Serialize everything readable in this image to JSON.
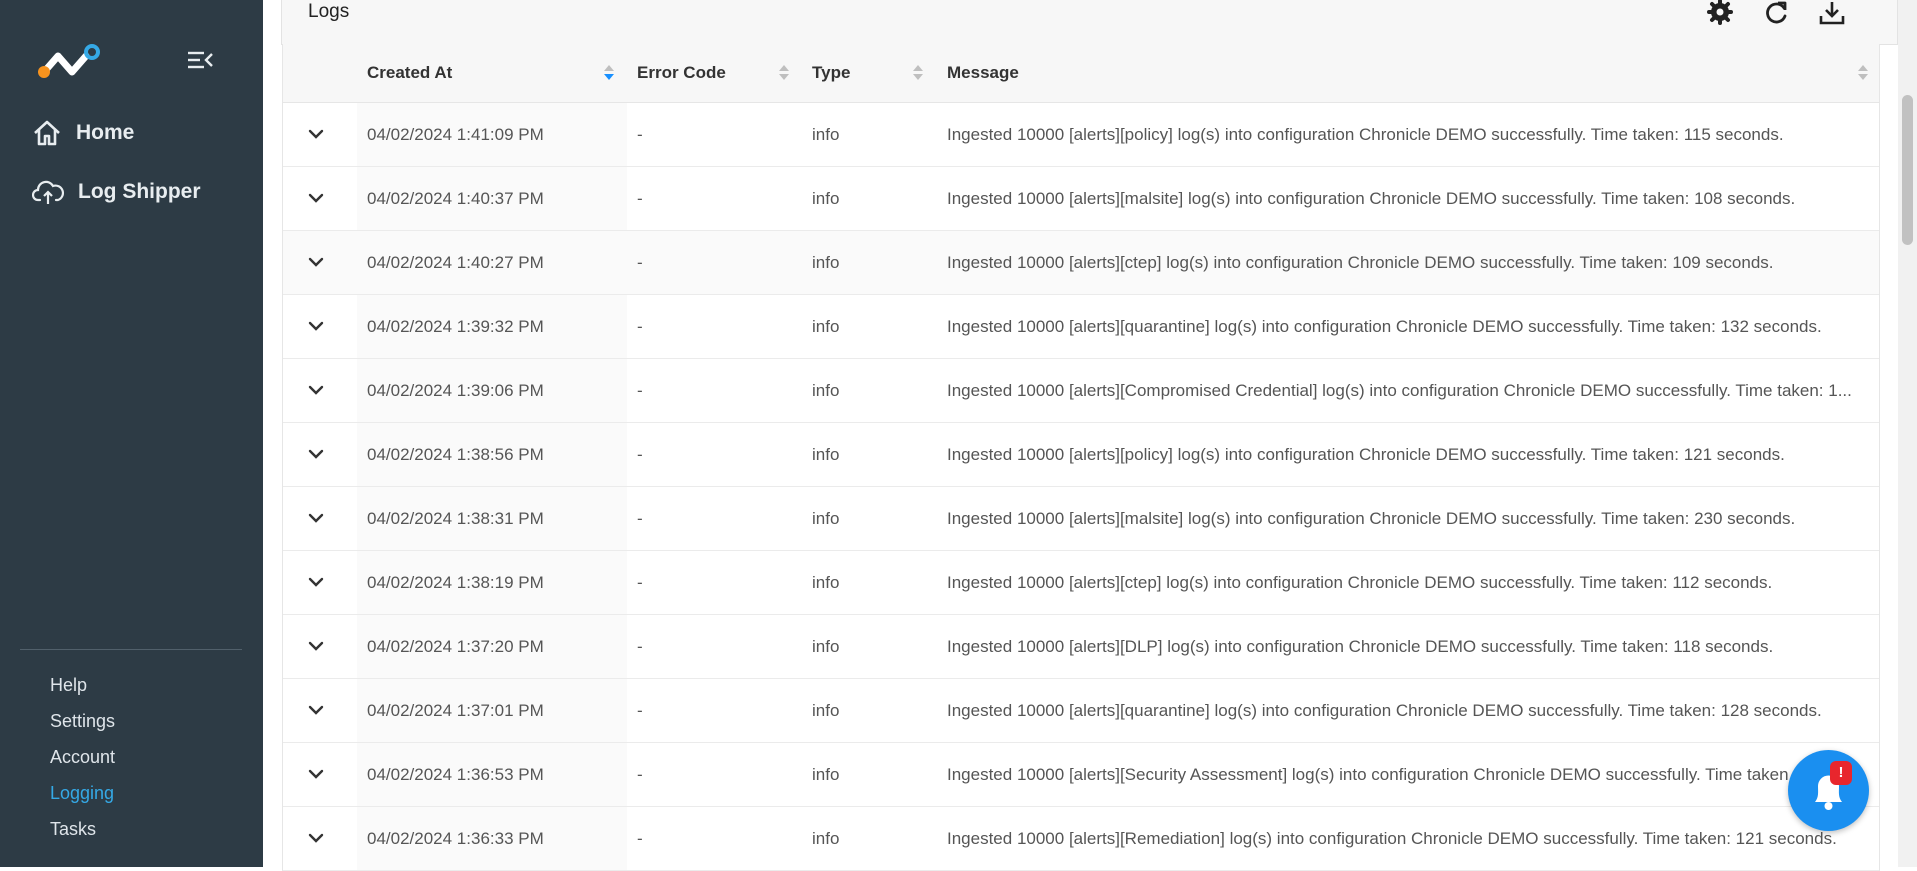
{
  "sidebar": {
    "nav": [
      {
        "label": "Home",
        "icon": "home-icon"
      },
      {
        "label": "Log Shipper",
        "icon": "cloud-upload-icon"
      }
    ],
    "links": [
      {
        "label": "Help",
        "active": false
      },
      {
        "label": "Settings",
        "active": false
      },
      {
        "label": "Account",
        "active": false
      },
      {
        "label": "Logging",
        "active": true
      },
      {
        "label": "Tasks",
        "active": false
      }
    ]
  },
  "logs": {
    "title": "Logs",
    "toolbar": [
      "gear-icon",
      "refresh-icon",
      "download-icon"
    ],
    "columns": [
      "Created At",
      "Error Code",
      "Type",
      "Message"
    ],
    "rows": [
      {
        "created": "04/02/2024 1:41:09 PM",
        "error": "-",
        "type": "info",
        "message": "Ingested 10000 [alerts][policy] log(s) into configuration Chronicle DEMO successfully. Time taken: 115 seconds."
      },
      {
        "created": "04/02/2024 1:40:37 PM",
        "error": "-",
        "type": "info",
        "message": "Ingested 10000 [alerts][malsite] log(s) into configuration Chronicle DEMO successfully. Time taken: 108 seconds."
      },
      {
        "created": "04/02/2024 1:40:27 PM",
        "error": "-",
        "type": "info",
        "message": "Ingested 10000 [alerts][ctep] log(s) into configuration Chronicle DEMO successfully. Time taken: 109 seconds."
      },
      {
        "created": "04/02/2024 1:39:32 PM",
        "error": "-",
        "type": "info",
        "message": "Ingested 10000 [alerts][quarantine] log(s) into configuration Chronicle DEMO successfully. Time taken: 132 seconds."
      },
      {
        "created": "04/02/2024 1:39:06 PM",
        "error": "-",
        "type": "info",
        "message": "Ingested 10000 [alerts][Compromised Credential] log(s) into configuration Chronicle DEMO successfully. Time taken: 1..."
      },
      {
        "created": "04/02/2024 1:38:56 PM",
        "error": "-",
        "type": "info",
        "message": "Ingested 10000 [alerts][policy] log(s) into configuration Chronicle DEMO successfully. Time taken: 121 seconds."
      },
      {
        "created": "04/02/2024 1:38:31 PM",
        "error": "-",
        "type": "info",
        "message": "Ingested 10000 [alerts][malsite] log(s) into configuration Chronicle DEMO successfully. Time taken: 230 seconds."
      },
      {
        "created": "04/02/2024 1:38:19 PM",
        "error": "-",
        "type": "info",
        "message": "Ingested 10000 [alerts][ctep] log(s) into configuration Chronicle DEMO successfully. Time taken: 112 seconds."
      },
      {
        "created": "04/02/2024 1:37:20 PM",
        "error": "-",
        "type": "info",
        "message": "Ingested 10000 [alerts][DLP] log(s) into configuration Chronicle DEMO successfully. Time taken: 118 seconds."
      },
      {
        "created": "04/02/2024 1:37:01 PM",
        "error": "-",
        "type": "info",
        "message": "Ingested 10000 [alerts][quarantine] log(s) into configuration Chronicle DEMO successfully. Time taken: 128 seconds."
      },
      {
        "created": "04/02/2024 1:36:53 PM",
        "error": "-",
        "type": "info",
        "message": "Ingested 10000 [alerts][Security Assessment] log(s) into configuration Chronicle DEMO successfully. Time taken"
      },
      {
        "created": "04/02/2024 1:36:33 PM",
        "error": "-",
        "type": "info",
        "message": "Ingested 10000 [alerts][Remediation] log(s) into configuration Chronicle DEMO successfully. Time taken: 121 seconds."
      }
    ]
  },
  "notification": {
    "badge": "!",
    "icon": "bell-icon"
  },
  "colors": {
    "sidebar": "#2d3b45",
    "accent": "#35a9e6",
    "fab": "#1a8ff0",
    "badge": "#e8262d"
  }
}
